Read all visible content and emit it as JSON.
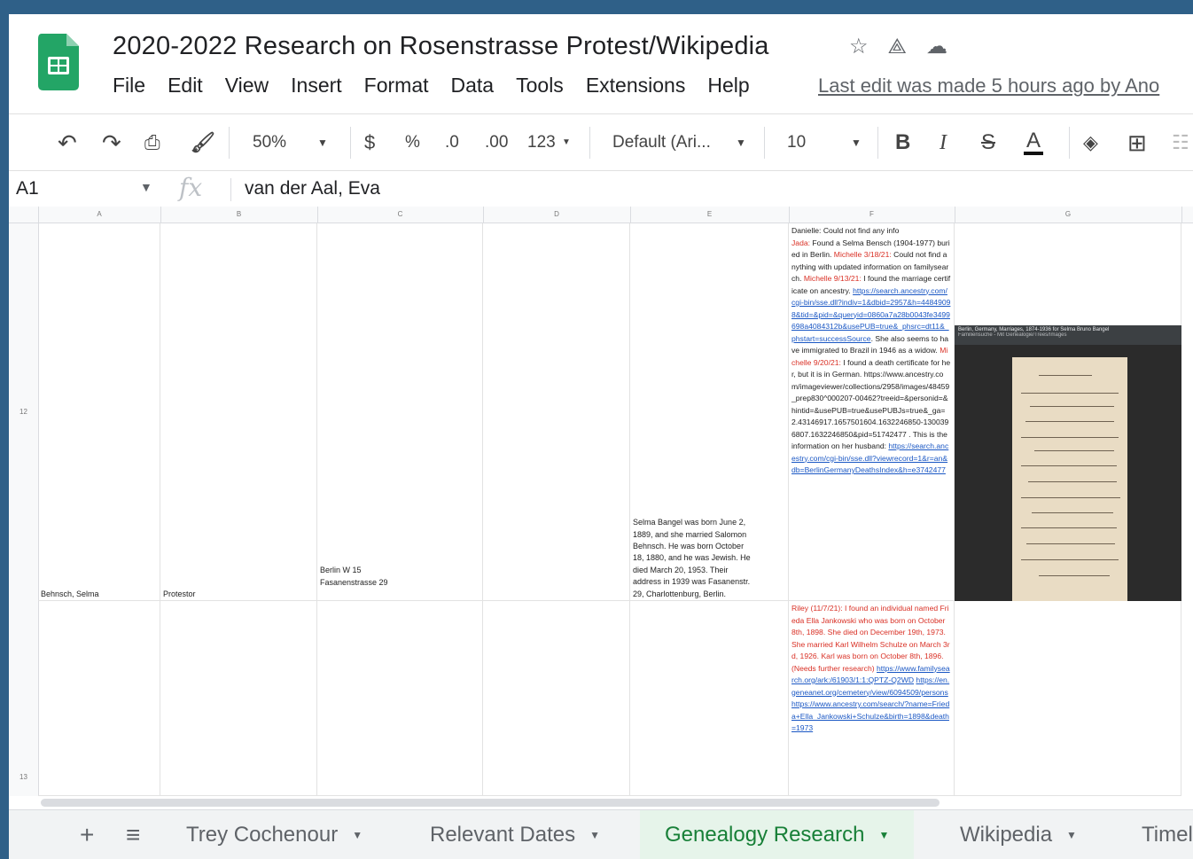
{
  "document": {
    "title": "2020-2022 Research on Rosenstrasse Protest/Wikipedia",
    "last_edit": "Last edit was made 5 hours ago by Ano"
  },
  "icons": {
    "app": "sheets-logo-icon",
    "star": "star-icon",
    "move": "move-to-drive-icon",
    "cloud": "cloud-status-icon"
  },
  "menu": [
    "File",
    "Edit",
    "View",
    "Insert",
    "Format",
    "Data",
    "Tools",
    "Extensions",
    "Help"
  ],
  "toolbar": {
    "zoom": "50%",
    "currency": "$",
    "percent": "%",
    "decrease_decimal": ".0",
    "increase_decimal": ".00",
    "more_formats": "123",
    "font": "Default (Ari...",
    "font_size": "10",
    "bold": "B",
    "italic": "I",
    "strikethrough": "S",
    "text_color": "A"
  },
  "formula_bar": {
    "cell_ref": "A1",
    "fx": "fx",
    "value": "van der Aal, Eva"
  },
  "columns": [
    "A",
    "B",
    "C",
    "D",
    "E",
    "F",
    "G"
  ],
  "rows": [
    {
      "number": "12",
      "a": "Behnsch, Selma",
      "b": "Protestor",
      "c": [
        "Berlin W 15",
        "Fasanenstrasse 29"
      ],
      "e": [
        "Selma Bangel was born June 2,",
        "1889, and she married Salomon",
        "Behnsch. He was born October",
        "18, 1880, and he was Jewish. He",
        "died March 20, 1953. Their",
        "address in 1939 was Fasanenstr.",
        "29, Charlottenburg, Berlin."
      ],
      "f": {
        "n1": "Danielle: Could not find any info",
        "n2_name": "Jada:",
        "n2": " Found a Selma Bensch (1904-1977) buried in Berlin.",
        "n3_name": "Michelle 3/18/21:",
        "n3": " Could not find anything with updated information on familysearch.",
        "n4_name": "Michelle 9/13/21:",
        "n4": " I found the marriage certificate on ancestry.",
        "link1": "https://search.ancestry.com/cgi-bin/sse.dll?indiv=1&dbid=2957&h=44849098&tid=&pid=&queryid=0860a7a28b0043fe3499698a4084312b&usePUB=true&_phsrc=dt11&_phstart=successSource",
        "n5": ". She also seems to have immigrated to Brazil in 1946 as a widow.",
        "n6_name": "Michelle 9/20/21:",
        "n6": " I found a death certificate for her, but it is in German.",
        "n7": "https://www.ancestry.com/imageviewer/collections/2958/images/48459_prep830^000207-00462?treeid=&personid=&hintid=&usePUB=true&usePUBJs=true&_ga=2.43146917.1657501604.1632246850-1300396807.1632246850&pid=5174247",
        "n8": "7 . This is the information on her husband:",
        "link2": "https://search.ancestry.com/cgi-bin/sse.dll?viewrecord=1&r=an&db=BerlinGermanyDeathsIndex&h=e3742477"
      },
      "g_image_caption": "Berlin, Germany, Marriages, 1874-1936 for Selma Bruno Bangel",
      "g_image_subcaption": "Familiensuche  -  Mit Genealogie/Trees/Images"
    },
    {
      "number": "13",
      "f": {
        "note": "Riley (11/7/21): I found an individual named Frieda Ella Jankowski who was born on October 8th, 1898. She died on December 19th, 1973. She married Karl Wilhelm Schulze on March 3rd, 1926. Karl was born on October 8th, 1896. (Needs further research)",
        "link1": "https://www.familysearch.org/ark:/61903/1:1:QPTZ-Q2WD",
        "link2": "https://en.geneanet.org/cemetery/view/6094509/persons",
        "link3": "https://www.ancestry.com/search/?name=Frieda+Ella_Jankowski+Schulze&birth=1898&death=1973"
      }
    }
  ],
  "sheet_tabs": {
    "add": "+",
    "all_sheets": "≡",
    "tabs": [
      "Trey Cochenour",
      "Relevant Dates",
      "Genealogy Research",
      "Wikipedia",
      "Timel"
    ],
    "active": "Genealogy Research"
  },
  "colors": {
    "accent_green": "#188038",
    "frame_blue": "#2f6088",
    "note_red": "#d93025",
    "link_blue": "#1a57c4"
  }
}
